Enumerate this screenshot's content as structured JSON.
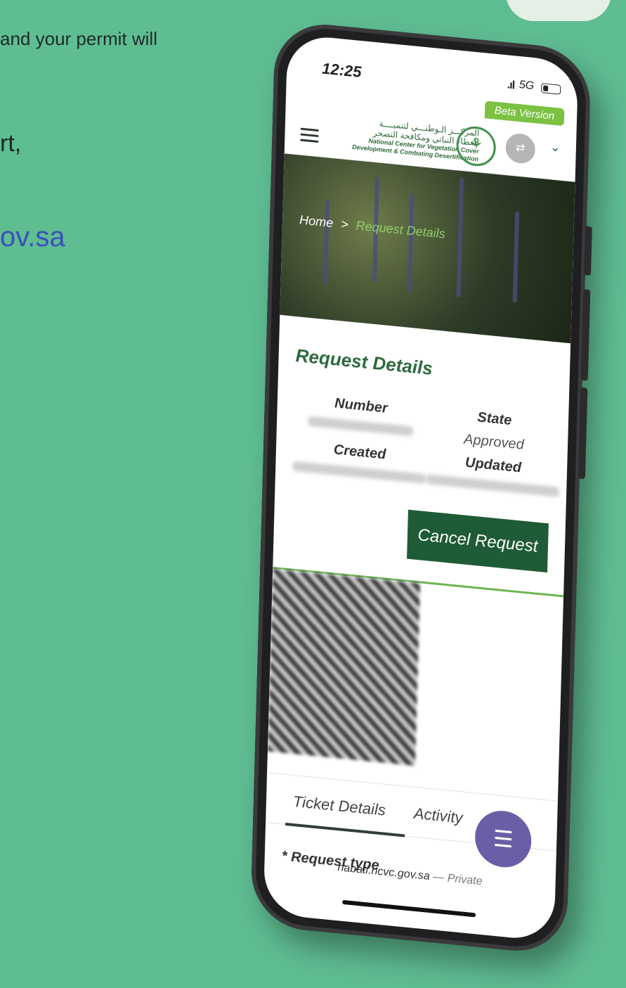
{
  "background": {
    "line1": "and your permit will",
    "line2": "rt,",
    "line3": "ov.sa"
  },
  "status_bar": {
    "time": "12:25",
    "signal": ".ıl",
    "network": "5G"
  },
  "header": {
    "beta_label": "Beta Version",
    "org_name_ar_1": "المركـــز الـوطنـــي لتنميــــة",
    "org_name_ar_2": "الغطاء النباتي ومكافحة التصحر",
    "org_name_en_1": "National Center for Vegetation Cover",
    "org_name_en_2": "Development & Combating Desertification"
  },
  "breadcrumb": {
    "home": "Home",
    "separator": ">",
    "current": "Request Details"
  },
  "details": {
    "title": "Request Details",
    "number_label": "Number",
    "state_label": "State",
    "state_value": "Approved",
    "created_label": "Created",
    "updated_label": "Updated",
    "cancel_button": "Cancel Request"
  },
  "tabs": {
    "ticket_details": "Ticket Details",
    "activity": "Activity"
  },
  "form": {
    "request_type_label": "* Request type"
  },
  "browser": {
    "domain": "nabati.ncvc.gov.sa",
    "privacy": "— Private"
  },
  "colors": {
    "background": "#5fbd92",
    "brand_green": "#2d6a3d",
    "button_green": "#1f5b36",
    "beta_green": "#7cc142",
    "chat_purple": "#6a5fa6"
  }
}
